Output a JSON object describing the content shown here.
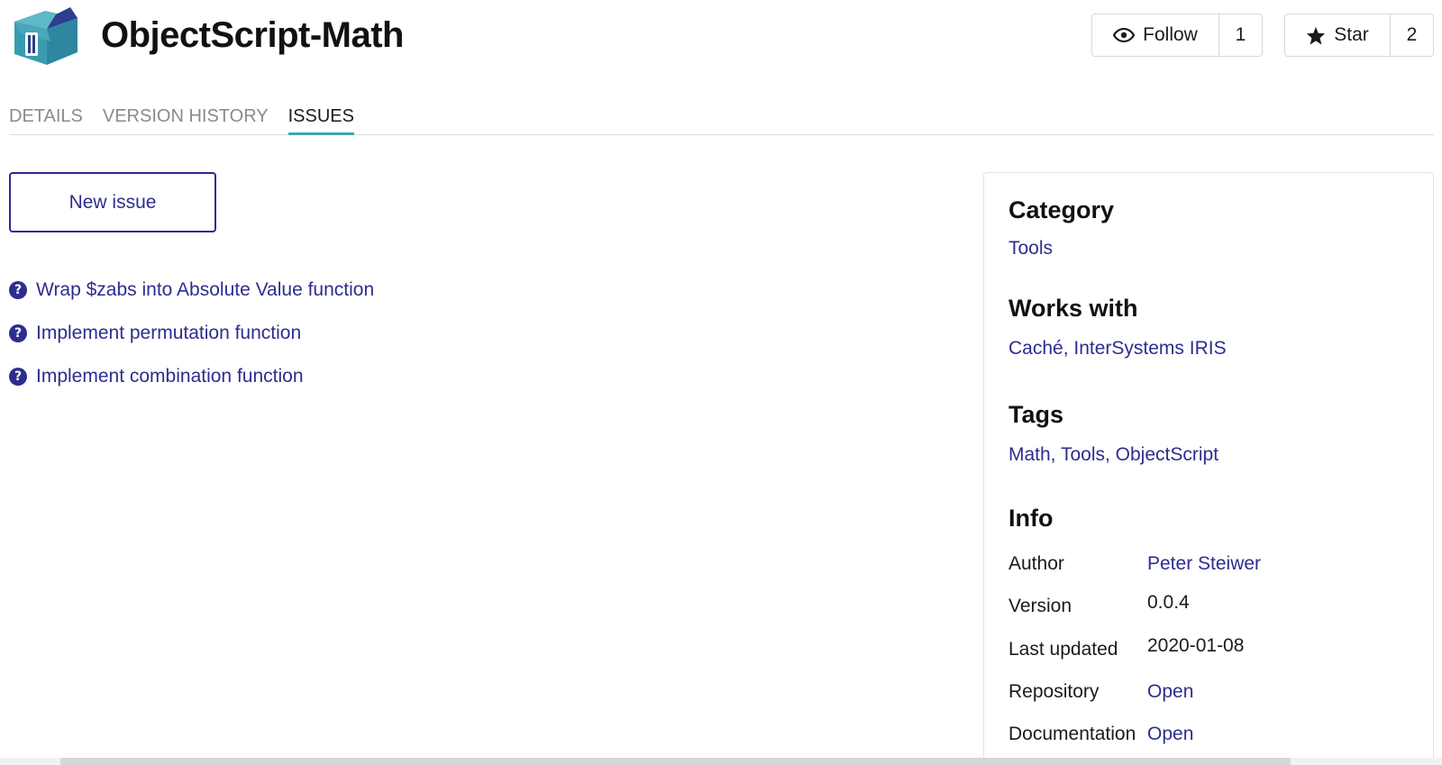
{
  "header": {
    "title": "ObjectScript-Math",
    "follow": {
      "label": "Follow",
      "count": "1"
    },
    "star": {
      "label": "Star",
      "count": "2"
    }
  },
  "tabs": [
    {
      "label": "DETAILS",
      "active": false
    },
    {
      "label": "VERSION HISTORY",
      "active": false
    },
    {
      "label": "ISSUES",
      "active": true
    }
  ],
  "new_issue_label": "New issue",
  "issues": [
    {
      "title": "Wrap $zabs into Absolute Value function",
      "icon": "question-icon"
    },
    {
      "title": "Implement permutation function",
      "icon": "question-icon"
    },
    {
      "title": "Implement combination function",
      "icon": "question-icon"
    }
  ],
  "sidebar": {
    "category": {
      "heading": "Category",
      "value": "Tools"
    },
    "works_with": {
      "heading": "Works with",
      "value": "Caché, InterSystems IRIS"
    },
    "tags": {
      "heading": "Tags",
      "value": "Math, Tools, ObjectScript"
    },
    "info": {
      "heading": "Info",
      "rows": [
        {
          "label": "Author",
          "value": "Peter Steiwer",
          "is_link": true
        },
        {
          "label": "Version",
          "value": "0.0.4",
          "is_link": false
        },
        {
          "label": "Last updated",
          "value": "2020-01-08",
          "is_link": false
        },
        {
          "label": "Repository",
          "value": "Open",
          "is_link": true
        },
        {
          "label": "Documentation",
          "value": "Open",
          "is_link": true
        }
      ]
    }
  },
  "colors": {
    "accent_link": "#2d2d8f",
    "tab_underline": "#3fa8a8",
    "logo_teal": "#3a9bb0",
    "logo_navy": "#2c3e8c"
  }
}
